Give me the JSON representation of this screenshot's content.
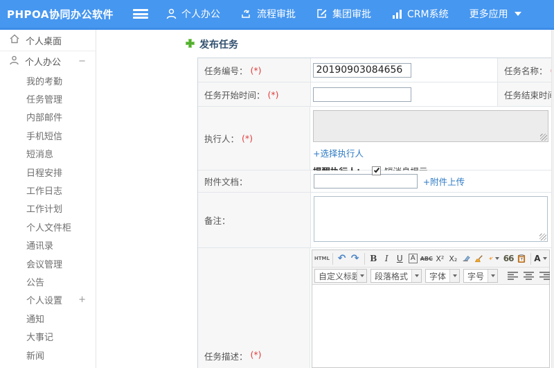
{
  "header": {
    "logo": "PHPOA协同办公软件",
    "nav": [
      {
        "label": "个人办公"
      },
      {
        "label": "流程审批"
      },
      {
        "label": "集团审批"
      },
      {
        "label": "CRM系统"
      },
      {
        "label": "更多应用"
      }
    ]
  },
  "sidebar": {
    "desktop": {
      "label": "个人桌面"
    },
    "office": {
      "label": "个人办公",
      "toggle": "−"
    },
    "submenu": [
      {
        "label": "我的考勤",
        "toggle": ""
      },
      {
        "label": "任务管理",
        "toggle": ""
      },
      {
        "label": "内部邮件",
        "toggle": ""
      },
      {
        "label": "手机短信",
        "toggle": ""
      },
      {
        "label": "短消息",
        "toggle": ""
      },
      {
        "label": "日程安排",
        "toggle": ""
      },
      {
        "label": "工作日志",
        "toggle": ""
      },
      {
        "label": "工作计划",
        "toggle": ""
      },
      {
        "label": "个人文件柜",
        "toggle": ""
      },
      {
        "label": "通讯录",
        "toggle": ""
      },
      {
        "label": "会议管理",
        "toggle": ""
      },
      {
        "label": "公告",
        "toggle": ""
      },
      {
        "label": "个人设置",
        "toggle": "+"
      },
      {
        "label": "通知",
        "toggle": ""
      },
      {
        "label": "大事记",
        "toggle": ""
      },
      {
        "label": "新闻",
        "toggle": ""
      }
    ]
  },
  "main": {
    "page_title": "发布任务",
    "form": {
      "required": "(*)",
      "task_no": {
        "label": "任务编号：",
        "value": "20190903084656"
      },
      "task_name": {
        "label": "任务名称："
      },
      "start_time": {
        "label": "任务开始时间："
      },
      "end_time": {
        "label": "任务结束时间："
      },
      "executor": {
        "label": "执行人：",
        "choose_link": "+选择执行人",
        "remind_label": "提醒执行人：",
        "sms_label": "短消息提示",
        "sms_checked": true
      },
      "attachment": {
        "label": "附件文档：",
        "upload_link": "+附件上传"
      },
      "remark": {
        "label": "备注："
      },
      "description": {
        "label": "任务描述："
      }
    },
    "editor": {
      "glyphs": {
        "html": "HTML",
        "undo": "↶",
        "redo": "↷",
        "bold": "B",
        "italic": "I",
        "underline": "U",
        "font_box": "A",
        "strike": "ABC",
        "sup": "X²",
        "sub": "X₂",
        "quote": "66",
        "color": "A"
      },
      "dropdowns": [
        {
          "label": "自定义标题"
        },
        {
          "label": "段落格式"
        },
        {
          "label": "字体"
        },
        {
          "label": "字号"
        }
      ]
    }
  },
  "colors": {
    "header_blue": "#4697f0",
    "accent_line": "#3d8de9",
    "link_blue": "#2e7bc4",
    "required_red": "#e23b3b",
    "plus_green": "#52ae30"
  }
}
